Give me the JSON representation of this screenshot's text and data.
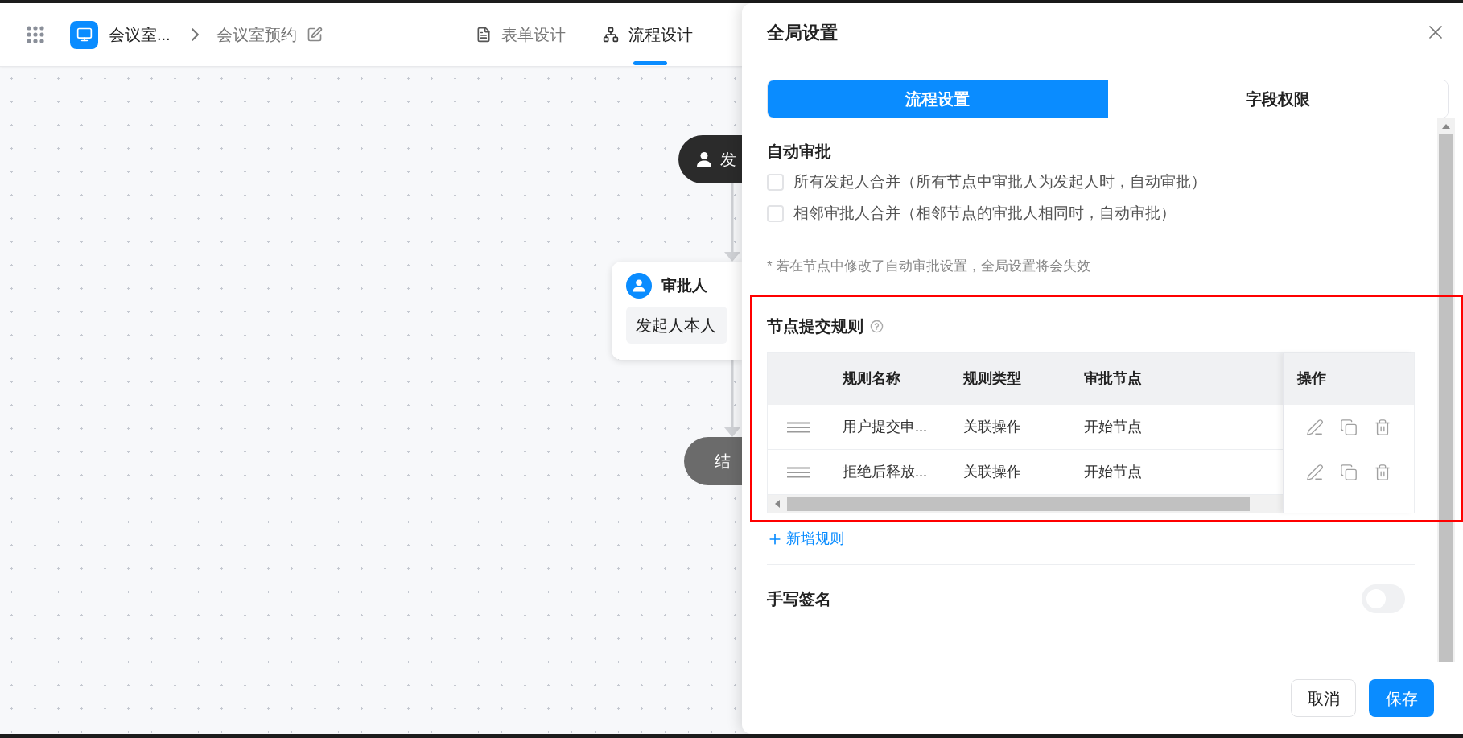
{
  "app_bar": {
    "app_name": "会议室...",
    "breadcrumb": "会议室预约",
    "tabs": [
      {
        "label": "表单设计",
        "selected": false
      },
      {
        "label": "流程设计",
        "selected": true
      }
    ]
  },
  "canvas": {
    "nodes": [
      {
        "kind": "start",
        "label": "发"
      },
      {
        "kind": "approver",
        "title": "审批人",
        "body": "发起人本人"
      },
      {
        "kind": "end",
        "label": "结"
      }
    ]
  },
  "panel": {
    "title": "全局设置",
    "tabs": [
      {
        "label": "流程设置",
        "selected": true
      },
      {
        "label": "字段权限",
        "selected": false
      }
    ],
    "auto_approval": {
      "title": "自动审批",
      "options": [
        {
          "label": "所有发起人合并（所有节点中审批人为发起人时，自动审批）",
          "checked": false
        },
        {
          "label": "相邻审批人合并（相邻节点的审批人相同时，自动审批）",
          "checked": false
        }
      ],
      "note": "* 若在节点中修改了自动审批设置，全局设置将会失效"
    },
    "rules": {
      "title": "节点提交规则",
      "columns": [
        "规则名称",
        "规则类型",
        "审批节点",
        "操作"
      ],
      "rows": [
        {
          "name": "用户提交申...",
          "type": "关联操作",
          "node": "开始节点"
        },
        {
          "name": "拒绝后释放...",
          "type": "关联操作",
          "node": "开始节点"
        }
      ],
      "add_label": "新增规则"
    },
    "signature": {
      "label": "手写签名",
      "on": false
    },
    "buttons": [
      {
        "label": "取消",
        "kind": "secondary"
      },
      {
        "label": "保存",
        "kind": "primary"
      }
    ]
  }
}
